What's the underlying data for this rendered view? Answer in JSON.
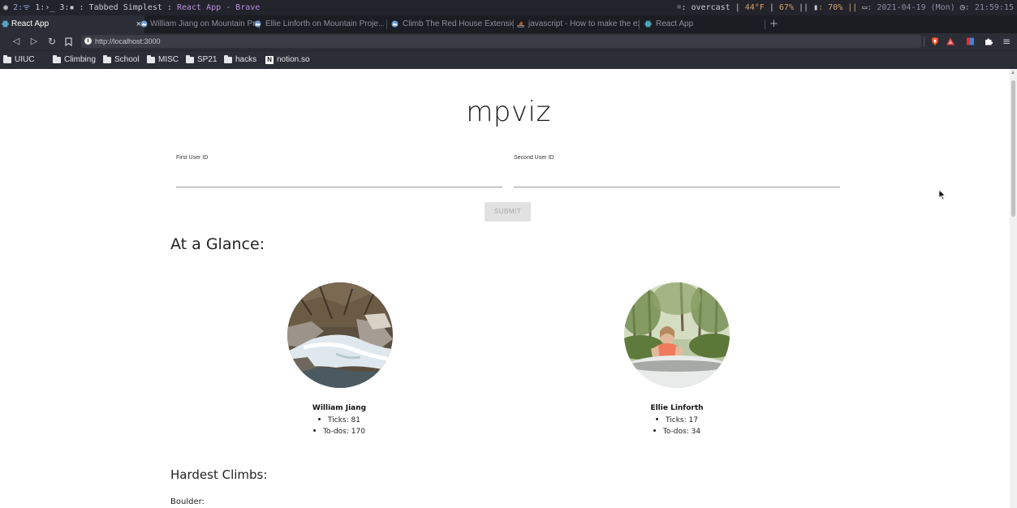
{
  "wm_bar": {
    "workspaces": [
      "2:",
      "1:",
      "3:"
    ],
    "window_prefix": ": Tabbed Simplest : ",
    "window_title": "React App - Brave",
    "weather_label": ": overcast |",
    "temperature": "44°F",
    "cpu": "67%",
    "mem_label": "||",
    "volume": ": 70% ||",
    "date": ": 2021-04-19 (Mon)",
    "time": ": 21:59:15"
  },
  "tabs": [
    {
      "label": "React App",
      "active": true,
      "icon": "react-icon"
    },
    {
      "label": "William Jiang on Mountain Proje...",
      "active": false,
      "icon": "mountain-project-icon"
    },
    {
      "label": "Ellie Linforth on Mountain Proje...",
      "active": false,
      "icon": "mountain-project-icon"
    },
    {
      "label": "Climb The Red House Extension...",
      "active": false,
      "icon": "mountain-project-icon"
    },
    {
      "label": "javascript - How to make the ex...",
      "active": false,
      "icon": "stackoverflow-icon"
    },
    {
      "label": "React App",
      "active": false,
      "icon": "react-icon"
    }
  ],
  "tab_close": "×",
  "new_tab": "+",
  "address": {
    "url": "http://localhost:3000"
  },
  "bookmarks": [
    {
      "label": "UIUC",
      "icon": "folder-icon"
    },
    {
      "label": "Climbing",
      "icon": "folder-icon"
    },
    {
      "label": "School",
      "icon": "folder-icon"
    },
    {
      "label": "MISC",
      "icon": "folder-icon"
    },
    {
      "label": "SP21",
      "icon": "folder-icon"
    },
    {
      "label": "hacks",
      "icon": "folder-icon"
    },
    {
      "label": "notion.so",
      "icon": "notion-icon"
    }
  ],
  "page": {
    "title": "mpviz",
    "first_user_label": "First User ID",
    "second_user_label": "Second User ID",
    "first_user_value": "",
    "second_user_value": "",
    "submit_label": "SUBMIT",
    "glance_heading": "At a Glance:",
    "users": [
      {
        "name": "William Jiang",
        "ticks": "Ticks: 81",
        "todos": "To-dos: 170"
      },
      {
        "name": "Ellie Linforth",
        "ticks": "Ticks: 17",
        "todos": "To-dos: 34"
      }
    ],
    "hardest_heading": "Hardest Climbs:",
    "boulder_label": "Boulder:"
  },
  "colors": {
    "chrome_dark": "#1c1d23",
    "toolbar": "#2c2e37",
    "brave_orange": "#fb542b",
    "submit_disabled": "#e1e1e1"
  }
}
